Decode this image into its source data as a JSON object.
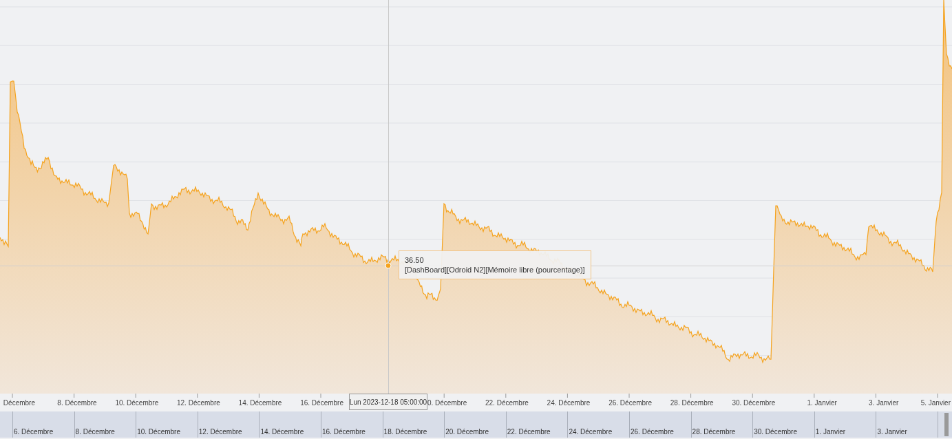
{
  "chart": {
    "tooltip": {
      "value": "36.50",
      "series": "[DashBoard][Odroid N2][Mémoire libre (pourcentage)]"
    },
    "crosshair_label": "Lun 2023-12-18 05:00:00",
    "x_axis_labels_left": [
      "Décembre",
      "8. Décembre",
      "10. Décembre",
      "12. Décembre",
      "14. Décembre",
      "16. Décembre"
    ],
    "x_axis_labels_right": [
      "0. Décembre",
      "22. Décembre",
      "24. Décembre",
      "26. Décembre",
      "28. Décembre",
      "30. Décembre",
      "1. Janvier",
      "3. Janvier",
      "5. Janvier"
    ],
    "navigator_labels": [
      "6. Décembre",
      "8. Décembre",
      "10. Décembre",
      "12. Décembre",
      "14. Décembre",
      "16. Décembre",
      "18. Décembre",
      "20. Décembre",
      "22. Décembre",
      "24. Décembre",
      "26. Décembre",
      "28. Décembre",
      "30. Décembre",
      "1. Janvier",
      "3. Janvier"
    ]
  }
}
